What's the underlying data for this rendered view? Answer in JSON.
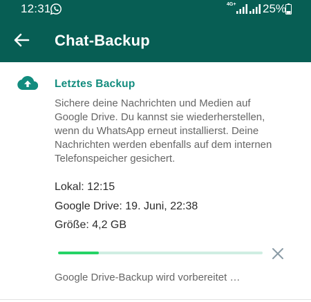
{
  "status_bar": {
    "time": "12:31",
    "network_label": "4G+",
    "battery": "25%",
    "icons": [
      "whatsapp-icon",
      "signal-icon",
      "signal-icon",
      "battery-icon"
    ]
  },
  "app_bar": {
    "title": "Chat-Backup",
    "back_icon": "arrow-left-icon"
  },
  "backup": {
    "section_icon": "cloud-upload-icon",
    "section_title": "Letztes Backup",
    "description": "Sichere deine Nachrichten und Medien auf Google Drive. Du kannst sie wiederherstellen, wenn du WhatsApp erneut installierst. Deine Nachrichten werden ebenfalls auf dem internen Telefonspeicher gesichert.",
    "local": "Lokal: 12:15",
    "google_drive": "Google Drive: 19. Juni, 22:38",
    "size": "Größe: 4,2 GB",
    "progress_fraction": 0.2,
    "progress_status": "Google Drive-Backup wird vorbereitet …",
    "cancel_icon": "close-icon"
  },
  "colors": {
    "primary_dark": "#075e54",
    "accent": "#128c7e",
    "progress": "#25d366",
    "progress_track": "#cfeee2"
  }
}
